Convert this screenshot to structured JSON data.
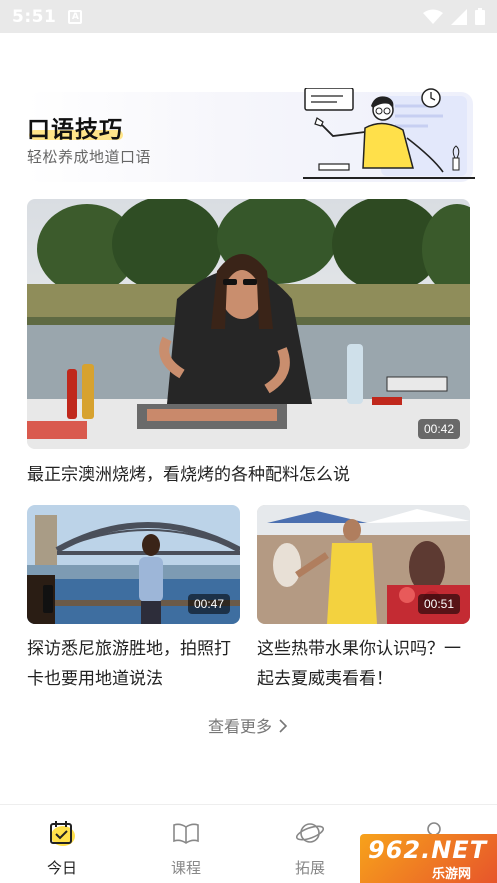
{
  "status_bar": {
    "time": "5:51",
    "notification_icon": "A"
  },
  "hero": {
    "title": "口语技巧",
    "subtitle": "轻松养成地道口语",
    "illustration": "teacher-at-whiteboard-illustration"
  },
  "featured_video": {
    "duration": "00:42",
    "title": "最正宗澳洲烧烤，看烧烤的各种配料怎么说"
  },
  "videos": [
    {
      "duration": "00:47",
      "title": "探访悉尼旅游胜地，拍照打卡也要用地道说法"
    },
    {
      "duration": "00:51",
      "title": "这些热带水果你认识吗？一起去夏威夷看看！"
    }
  ],
  "more_label": "查看更多",
  "tabs": [
    {
      "label": "今日",
      "icon": "calendar-check-icon",
      "active": true
    },
    {
      "label": "课程",
      "icon": "open-book-icon",
      "active": false
    },
    {
      "label": "拓展",
      "icon": "planet-icon",
      "active": false
    },
    {
      "label": "",
      "icon": "profile-icon",
      "active": false
    }
  ],
  "watermark": {
    "big": "962.NET",
    "small": "乐游网"
  },
  "colors": {
    "accent_yellow": "#ffe04a",
    "highlight": "#ffe58a",
    "text_dark": "#222222",
    "text_muted": "#888888"
  }
}
